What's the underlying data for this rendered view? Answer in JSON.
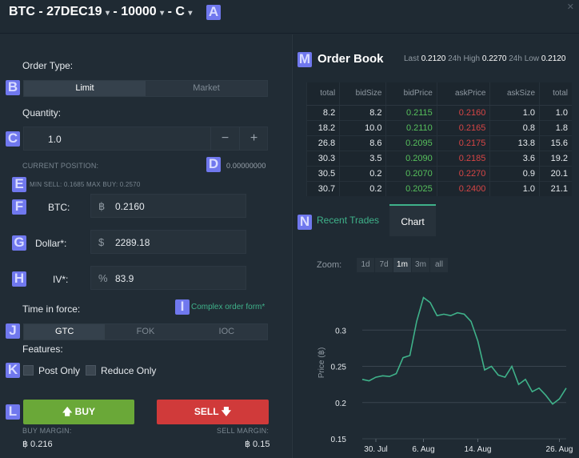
{
  "header": {
    "instrument": "BTC",
    "expiry": "27DEC19",
    "strike": "10000",
    "option_type": "C",
    "separator": " - ",
    "caret": "▾",
    "close": "✕"
  },
  "markers": [
    "A",
    "B",
    "C",
    "D",
    "E",
    "F",
    "G",
    "H",
    "I",
    "J",
    "K",
    "L",
    "M",
    "N"
  ],
  "order": {
    "order_type_label": "Order Type:",
    "order_types": [
      "Limit",
      "Market"
    ],
    "quantity_label": "Quantity:",
    "quantity_value": "1.0",
    "minus": "−",
    "plus": "+",
    "current_position_label": "CURRENT POSITION:",
    "current_position_value": "0.00000000",
    "min_max": "MIN SELL: 0.1685  MAX BUY: 0.2570",
    "btc_label": "BTC:",
    "btc_symbol": "฿",
    "btc_value": "0.2160",
    "dollar_label": "Dollar*:",
    "dollar_symbol": "$",
    "dollar_value": "2289.18",
    "iv_label": "IV*:",
    "iv_symbol": "%",
    "iv_value": "83.9",
    "tif_label": "Time in force:",
    "complex_link": "Complex order form*",
    "tif_options": [
      "GTC",
      "FOK",
      "IOC"
    ],
    "features_label": "Features:",
    "post_only": "Post Only",
    "reduce_only": "Reduce Only",
    "buy_label": "BUY",
    "sell_label": "SELL",
    "buy_margin_label": "BUY MARGIN:",
    "buy_margin_value": "฿ 0.216",
    "sell_margin_label": "SELL MARGIN:",
    "sell_margin_value": "฿ 0.15"
  },
  "orderbook": {
    "title": "Order Book",
    "last_label": "Last",
    "last_value": "0.2120",
    "high_label": "24h High",
    "high_value": "0.2270",
    "low_label": "24h Low",
    "low_value": "0.2120",
    "columns": [
      "total",
      "bidSize",
      "bidPrice",
      "askPrice",
      "askSize",
      "total"
    ],
    "rows": [
      [
        "8.2",
        "8.2",
        "0.2115",
        "0.2160",
        "1.0",
        "1.0"
      ],
      [
        "18.2",
        "10.0",
        "0.2110",
        "0.2165",
        "0.8",
        "1.8"
      ],
      [
        "26.8",
        "8.6",
        "0.2095",
        "0.2175",
        "13.8",
        "15.6"
      ],
      [
        "30.3",
        "3.5",
        "0.2090",
        "0.2185",
        "3.6",
        "19.2"
      ],
      [
        "30.5",
        "0.2",
        "0.2070",
        "0.2270",
        "0.9",
        "20.1"
      ],
      [
        "30.7",
        "0.2",
        "0.2025",
        "0.2400",
        "1.0",
        "21.1"
      ]
    ]
  },
  "tabs": {
    "recent_trades": "Recent Trades",
    "chart": "Chart"
  },
  "zoom": {
    "label": "Zoom:",
    "options": [
      "1d",
      "7d",
      "1m",
      "3m",
      "all"
    ],
    "active": "1m"
  },
  "chart_data": {
    "type": "line",
    "ylabel": "Price (฿)",
    "ylim": [
      0.15,
      0.36
    ],
    "yticks": [
      "0.3",
      "0.25",
      "0.2",
      "0.15"
    ],
    "xticks": [
      "30. Jul",
      "6. Aug",
      "14. Aug",
      "26. Aug"
    ],
    "series": [
      {
        "color": "#3fb28a",
        "x": [
          "2019-07-28",
          "2019-07-29",
          "2019-07-30",
          "2019-07-31",
          "2019-08-01",
          "2019-08-02",
          "2019-08-03",
          "2019-08-04",
          "2019-08-05",
          "2019-08-06",
          "2019-08-07",
          "2019-08-08",
          "2019-08-09",
          "2019-08-10",
          "2019-08-11",
          "2019-08-12",
          "2019-08-13",
          "2019-08-14",
          "2019-08-15",
          "2019-08-16",
          "2019-08-17",
          "2019-08-18",
          "2019-08-19",
          "2019-08-20",
          "2019-08-21",
          "2019-08-22",
          "2019-08-23",
          "2019-08-24",
          "2019-08-25",
          "2019-08-26",
          "2019-08-27"
        ],
        "values": [
          0.232,
          0.23,
          0.235,
          0.237,
          0.236,
          0.24,
          0.262,
          0.265,
          0.312,
          0.345,
          0.338,
          0.32,
          0.322,
          0.32,
          0.324,
          0.322,
          0.312,
          0.285,
          0.245,
          0.25,
          0.238,
          0.235,
          0.25,
          0.225,
          0.232,
          0.215,
          0.22,
          0.21,
          0.198,
          0.205,
          0.22
        ]
      }
    ]
  }
}
